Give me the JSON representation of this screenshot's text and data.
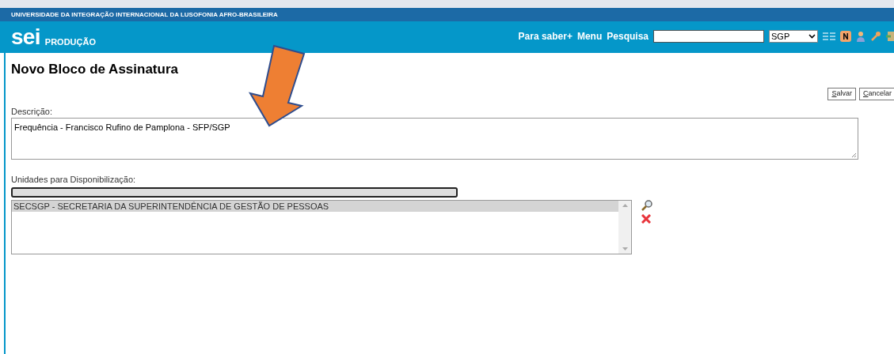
{
  "header": {
    "institution": "UNIVERSIDADE DA INTEGRAÇÃO INTERNACIONAL DA LUSOFONIA AFRO-BRASILEIRA",
    "logo": "sei",
    "environment": "PRODUÇÃO",
    "links": [
      "Para saber+",
      "Menu",
      "Pesquisa"
    ],
    "unit_select": "SGP"
  },
  "page": {
    "title": "Novo Bloco de Assinatura",
    "buttons": [
      "Salvar",
      "Cancelar"
    ],
    "description": {
      "label": "Descrição:",
      "value": "Frequência - Francisco Rufino de Pamplona - SFP/SGP"
    },
    "units": {
      "label": "Unidades para Disponibilização:",
      "items": [
        {
          "text": "SECSGP - SECRETARIA DA SUPERINTENDÊNCIA DE GESTÃO DE PESSOAS",
          "selected": true
        }
      ]
    }
  }
}
